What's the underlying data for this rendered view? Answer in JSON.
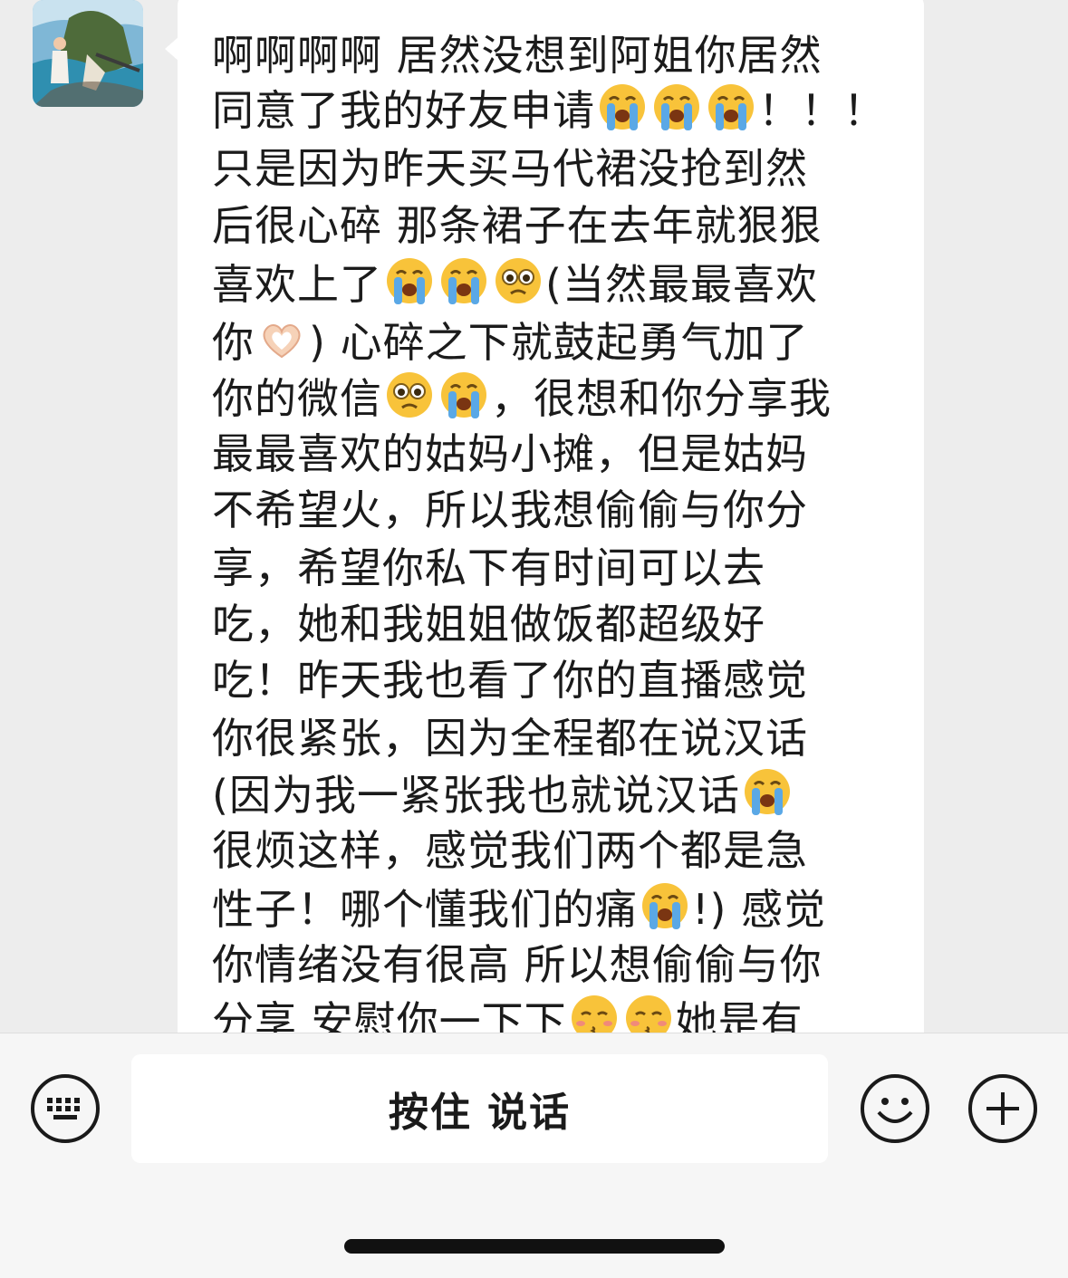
{
  "message": {
    "lines": [
      "啊啊啊啊 居然没想到阿姐你居然",
      "同意了我的好友申请",
      " 只是因为昨天买马代裙没抢到然",
      "后很心碎 那条裙子在去年就狠狠",
      "喜欢上了",
      "(当然最最喜欢",
      "你",
      ") 心碎之下就鼓起勇气加了",
      "你的微信",
      "，很想和你分享我",
      "最最喜欢的姑妈小摊，但是姑妈",
      "不希望火，所以我想偷偷与你分",
      "享，希望你私下有时间可以去",
      "吃，她和我姐姐做饭都超级好",
      "吃！昨天我也看了你的直播感觉",
      "你很紧张，因为全程都在说汉话",
      "(因为我一紧张我也就说汉话",
      "很烦这样，感觉我们两个都是急",
      "性子！哪个懂我们的痛",
      "!) 感觉",
      "你情绪没有很高 所以想偷偷与你",
      "分享 安慰你一下下",
      "她是有"
    ],
    "exclaim": "！！！"
  },
  "input_bar": {
    "hold_to_talk_label": "按住 说话",
    "keyboard_icon": "keyboard-icon",
    "emoji_icon": "emoji-face-icon",
    "plus_icon": "plus-icon"
  },
  "colors": {
    "background": "#ededed",
    "bubble": "#ffffff",
    "text": "#1b1b1b"
  }
}
